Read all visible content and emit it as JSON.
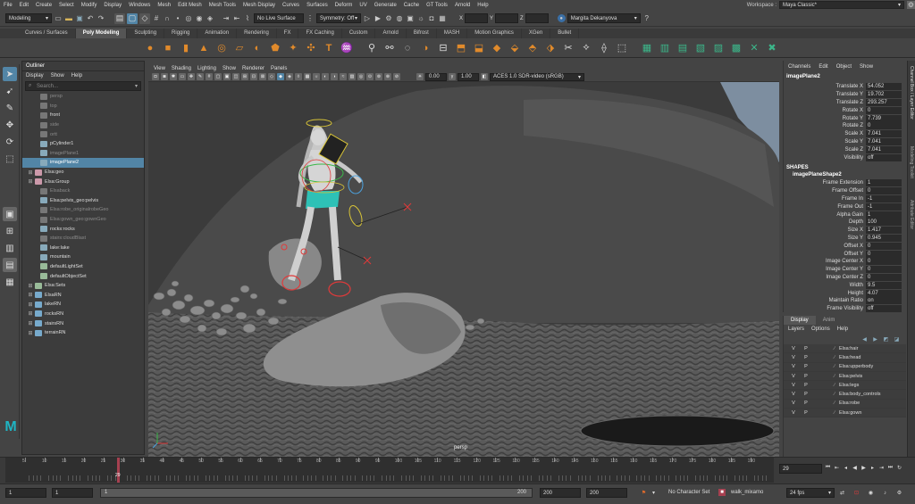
{
  "menubar": {
    "items": [
      "File",
      "Edit",
      "Create",
      "Select",
      "Modify",
      "Display",
      "Windows",
      "Mesh",
      "Edit Mesh",
      "Mesh Tools",
      "Mesh Display",
      "Curves",
      "Surfaces",
      "Deform",
      "UV",
      "Generate",
      "Cache",
      "GT Tools",
      "Arnold",
      "Help"
    ],
    "workspace_label": "Workspace :",
    "workspace_value": "Maya Classic*"
  },
  "statusline": {
    "mode": "Modeling",
    "live_surface": "No Live Surface",
    "symmetry": "Symmetry: Off",
    "x_label": "X",
    "y_label": "Y",
    "z_label": "Z",
    "user": "Margita Dekanyova"
  },
  "shelf_tabs": [
    "Curves / Surfaces",
    "Poly Modeling",
    "Sculpting",
    "Rigging",
    "Animation",
    "Rendering",
    "FX",
    "FX Caching",
    "Custom",
    "Arnold",
    "Bifrost",
    "MASH",
    "Motion Graphics",
    "XGen",
    "Bullet"
  ],
  "shelf_active": "Poly Modeling",
  "outliner": {
    "title": "Outliner",
    "menus": [
      "Display",
      "Show",
      "Help"
    ],
    "search_placeholder": "Search...",
    "rows": [
      {
        "label": "persp",
        "dim": true,
        "expand": "",
        "icon": "camera-icon",
        "color": "#777"
      },
      {
        "label": "top",
        "dim": true,
        "expand": "",
        "icon": "camera-icon",
        "color": "#777"
      },
      {
        "label": "front",
        "dim": false,
        "expand": "",
        "icon": "camera-icon",
        "color": "#777"
      },
      {
        "label": "side",
        "dim": true,
        "expand": "",
        "icon": "camera-icon",
        "color": "#777"
      },
      {
        "label": "ortt",
        "dim": true,
        "expand": "",
        "icon": "camera-icon",
        "color": "#777"
      },
      {
        "label": "pCylinder1",
        "dim": false,
        "expand": "",
        "icon": "mesh-icon",
        "color": "#8ab"
      },
      {
        "label": "imagePlane1",
        "dim": true,
        "expand": "",
        "icon": "image-plane-icon",
        "color": "#8ab"
      },
      {
        "label": "imagePlane2",
        "dim": false,
        "expand": "",
        "icon": "image-plane-icon",
        "color": "#8ab",
        "selected": true
      },
      {
        "label": "Elsa:geo",
        "dim": false,
        "expand": "+",
        "icon": "group-icon",
        "color": "#c9a"
      },
      {
        "label": "Elsa:Group",
        "dim": false,
        "expand": "+",
        "icon": "group-icon",
        "color": "#c9a"
      },
      {
        "label": "Elsaback",
        "dim": true,
        "expand": "",
        "icon": "mesh-icon",
        "color": "#777"
      },
      {
        "label": "Elsa:pelvis_geo:pelvis",
        "dim": false,
        "expand": "",
        "icon": "mesh-icon",
        "color": "#8ab"
      },
      {
        "label": "Elsa:robe_originalrobeGeo",
        "dim": true,
        "expand": "",
        "icon": "mesh-icon",
        "color": "#777"
      },
      {
        "label": "Elsa:gown_geo:gownGeo",
        "dim": true,
        "expand": "",
        "icon": "mesh-icon",
        "color": "#777"
      },
      {
        "label": "rocks:rocks",
        "dim": false,
        "expand": "",
        "icon": "mesh-icon",
        "color": "#8ab"
      },
      {
        "label": "stairs:cloudBlast",
        "dim": true,
        "expand": "",
        "icon": "mesh-icon",
        "color": "#777"
      },
      {
        "label": "lake:lake",
        "dim": false,
        "expand": "",
        "icon": "mesh-icon",
        "color": "#8ab"
      },
      {
        "label": "mountain",
        "dim": false,
        "expand": "",
        "icon": "mesh-icon",
        "color": "#8ab"
      },
      {
        "label": "defaultLightSet",
        "dim": false,
        "expand": "",
        "icon": "set-icon",
        "color": "#9b9"
      },
      {
        "label": "defaultObjectSet",
        "dim": false,
        "expand": "",
        "icon": "set-icon",
        "color": "#9b9"
      },
      {
        "label": "Elsa:Sets",
        "dim": false,
        "expand": "+",
        "icon": "set-icon",
        "color": "#9b9"
      },
      {
        "label": "ElsaRN",
        "dim": false,
        "expand": "+",
        "icon": "reference-icon",
        "color": "#7ac"
      },
      {
        "label": "lakeRN",
        "dim": false,
        "expand": "+",
        "icon": "reference-icon",
        "color": "#7ac"
      },
      {
        "label": "rocksRN",
        "dim": false,
        "expand": "+",
        "icon": "reference-icon",
        "color": "#7ac"
      },
      {
        "label": "stairsRN",
        "dim": false,
        "expand": "+",
        "icon": "reference-icon",
        "color": "#7ac"
      },
      {
        "label": "terrainRN",
        "dim": false,
        "expand": "+",
        "icon": "reference-icon",
        "color": "#7ac"
      }
    ]
  },
  "viewport": {
    "menus": [
      "View",
      "Shading",
      "Lighting",
      "Show",
      "Renderer",
      "Panels"
    ],
    "exposure": "0.00",
    "gamma": "1.00",
    "color_space": "ACES 1.0 SDR-video (sRGB)",
    "camera_label": "persp"
  },
  "channel_box": {
    "menus": [
      "Channels",
      "Edit",
      "Object",
      "Show"
    ],
    "node": "imagePlane2",
    "attrs": [
      {
        "name": "Translate X",
        "value": "54.052"
      },
      {
        "name": "Translate Y",
        "value": "19.702"
      },
      {
        "name": "Translate Z",
        "value": "293.257"
      },
      {
        "name": "Rotate X",
        "value": "0"
      },
      {
        "name": "Rotate Y",
        "value": "7.739"
      },
      {
        "name": "Rotate Z",
        "value": "0"
      },
      {
        "name": "Scale X",
        "value": "7.041"
      },
      {
        "name": "Scale Y",
        "value": "7.041"
      },
      {
        "name": "Scale Z",
        "value": "7.041"
      },
      {
        "name": "Visibility",
        "value": "off"
      }
    ],
    "shapes_header": "SHAPES",
    "shape_node": "imagePlaneShape2",
    "shape_attrs": [
      {
        "name": "Frame Extension",
        "value": "1"
      },
      {
        "name": "Frame Offset",
        "value": "0"
      },
      {
        "name": "Frame In",
        "value": "-1"
      },
      {
        "name": "Frame Out",
        "value": "-1"
      },
      {
        "name": "Alpha Gain",
        "value": "1"
      },
      {
        "name": "Depth",
        "value": "100"
      },
      {
        "name": "Size X",
        "value": "1.417"
      },
      {
        "name": "Size Y",
        "value": "0.945"
      },
      {
        "name": "Offset X",
        "value": "0"
      },
      {
        "name": "Offset Y",
        "value": "0"
      },
      {
        "name": "Image Center X",
        "value": "0"
      },
      {
        "name": "Image Center Y",
        "value": "0"
      },
      {
        "name": "Image Center Z",
        "value": "0"
      },
      {
        "name": "Width",
        "value": "9.5"
      },
      {
        "name": "Height",
        "value": "4.07"
      },
      {
        "name": "Maintain Ratio",
        "value": "on"
      },
      {
        "name": "Frame Visibility",
        "value": "off"
      }
    ]
  },
  "side_tabs": [
    "Channel Box / Layer Editor",
    "Modeling Toolkit",
    "Attribute Editor"
  ],
  "layer_editor": {
    "tabs": [
      "Display",
      "Anim"
    ],
    "menus": [
      "Layers",
      "Options",
      "Help"
    ],
    "layers": [
      {
        "v": "V",
        "p": "P",
        "name": "Elsa:hair"
      },
      {
        "v": "V",
        "p": "P",
        "name": "Elsa:head"
      },
      {
        "v": "V",
        "p": "P",
        "name": "Elsa:upperbody"
      },
      {
        "v": "V",
        "p": "P",
        "name": "Elsa:pelvis"
      },
      {
        "v": "V",
        "p": "P",
        "name": "Elsa:legs"
      },
      {
        "v": "V",
        "p": "P",
        "name": "Elsa:body_controls"
      },
      {
        "v": "V",
        "p": "P",
        "name": "Elsa:robe"
      },
      {
        "v": "V",
        "p": "P",
        "name": "Elsa:gown"
      }
    ]
  },
  "timeline": {
    "ticks": [
      "5",
      "10",
      "15",
      "20",
      "25",
      "30",
      "35",
      "40",
      "45",
      "50",
      "55",
      "60",
      "65",
      "70",
      "75",
      "80",
      "85",
      "90",
      "95",
      "100",
      "105",
      "110",
      "115",
      "120",
      "125",
      "130",
      "135",
      "140",
      "145",
      "150",
      "155",
      "160",
      "165",
      "170",
      "175",
      "180",
      "185",
      "190"
    ],
    "current_frame": "29",
    "current_marker": "29"
  },
  "range": {
    "start": "1",
    "start_inner": "1",
    "slider_start": "1",
    "slider_end": "200",
    "end_inner": "200",
    "end": "200",
    "character_set": "No Character Set",
    "anim_layer": "walk_mixamo",
    "fps": "24 fps"
  },
  "colors": {
    "accent": "#5285a6",
    "maya_logo": "#1fb5c4",
    "timeline_marker": "#a64050"
  }
}
